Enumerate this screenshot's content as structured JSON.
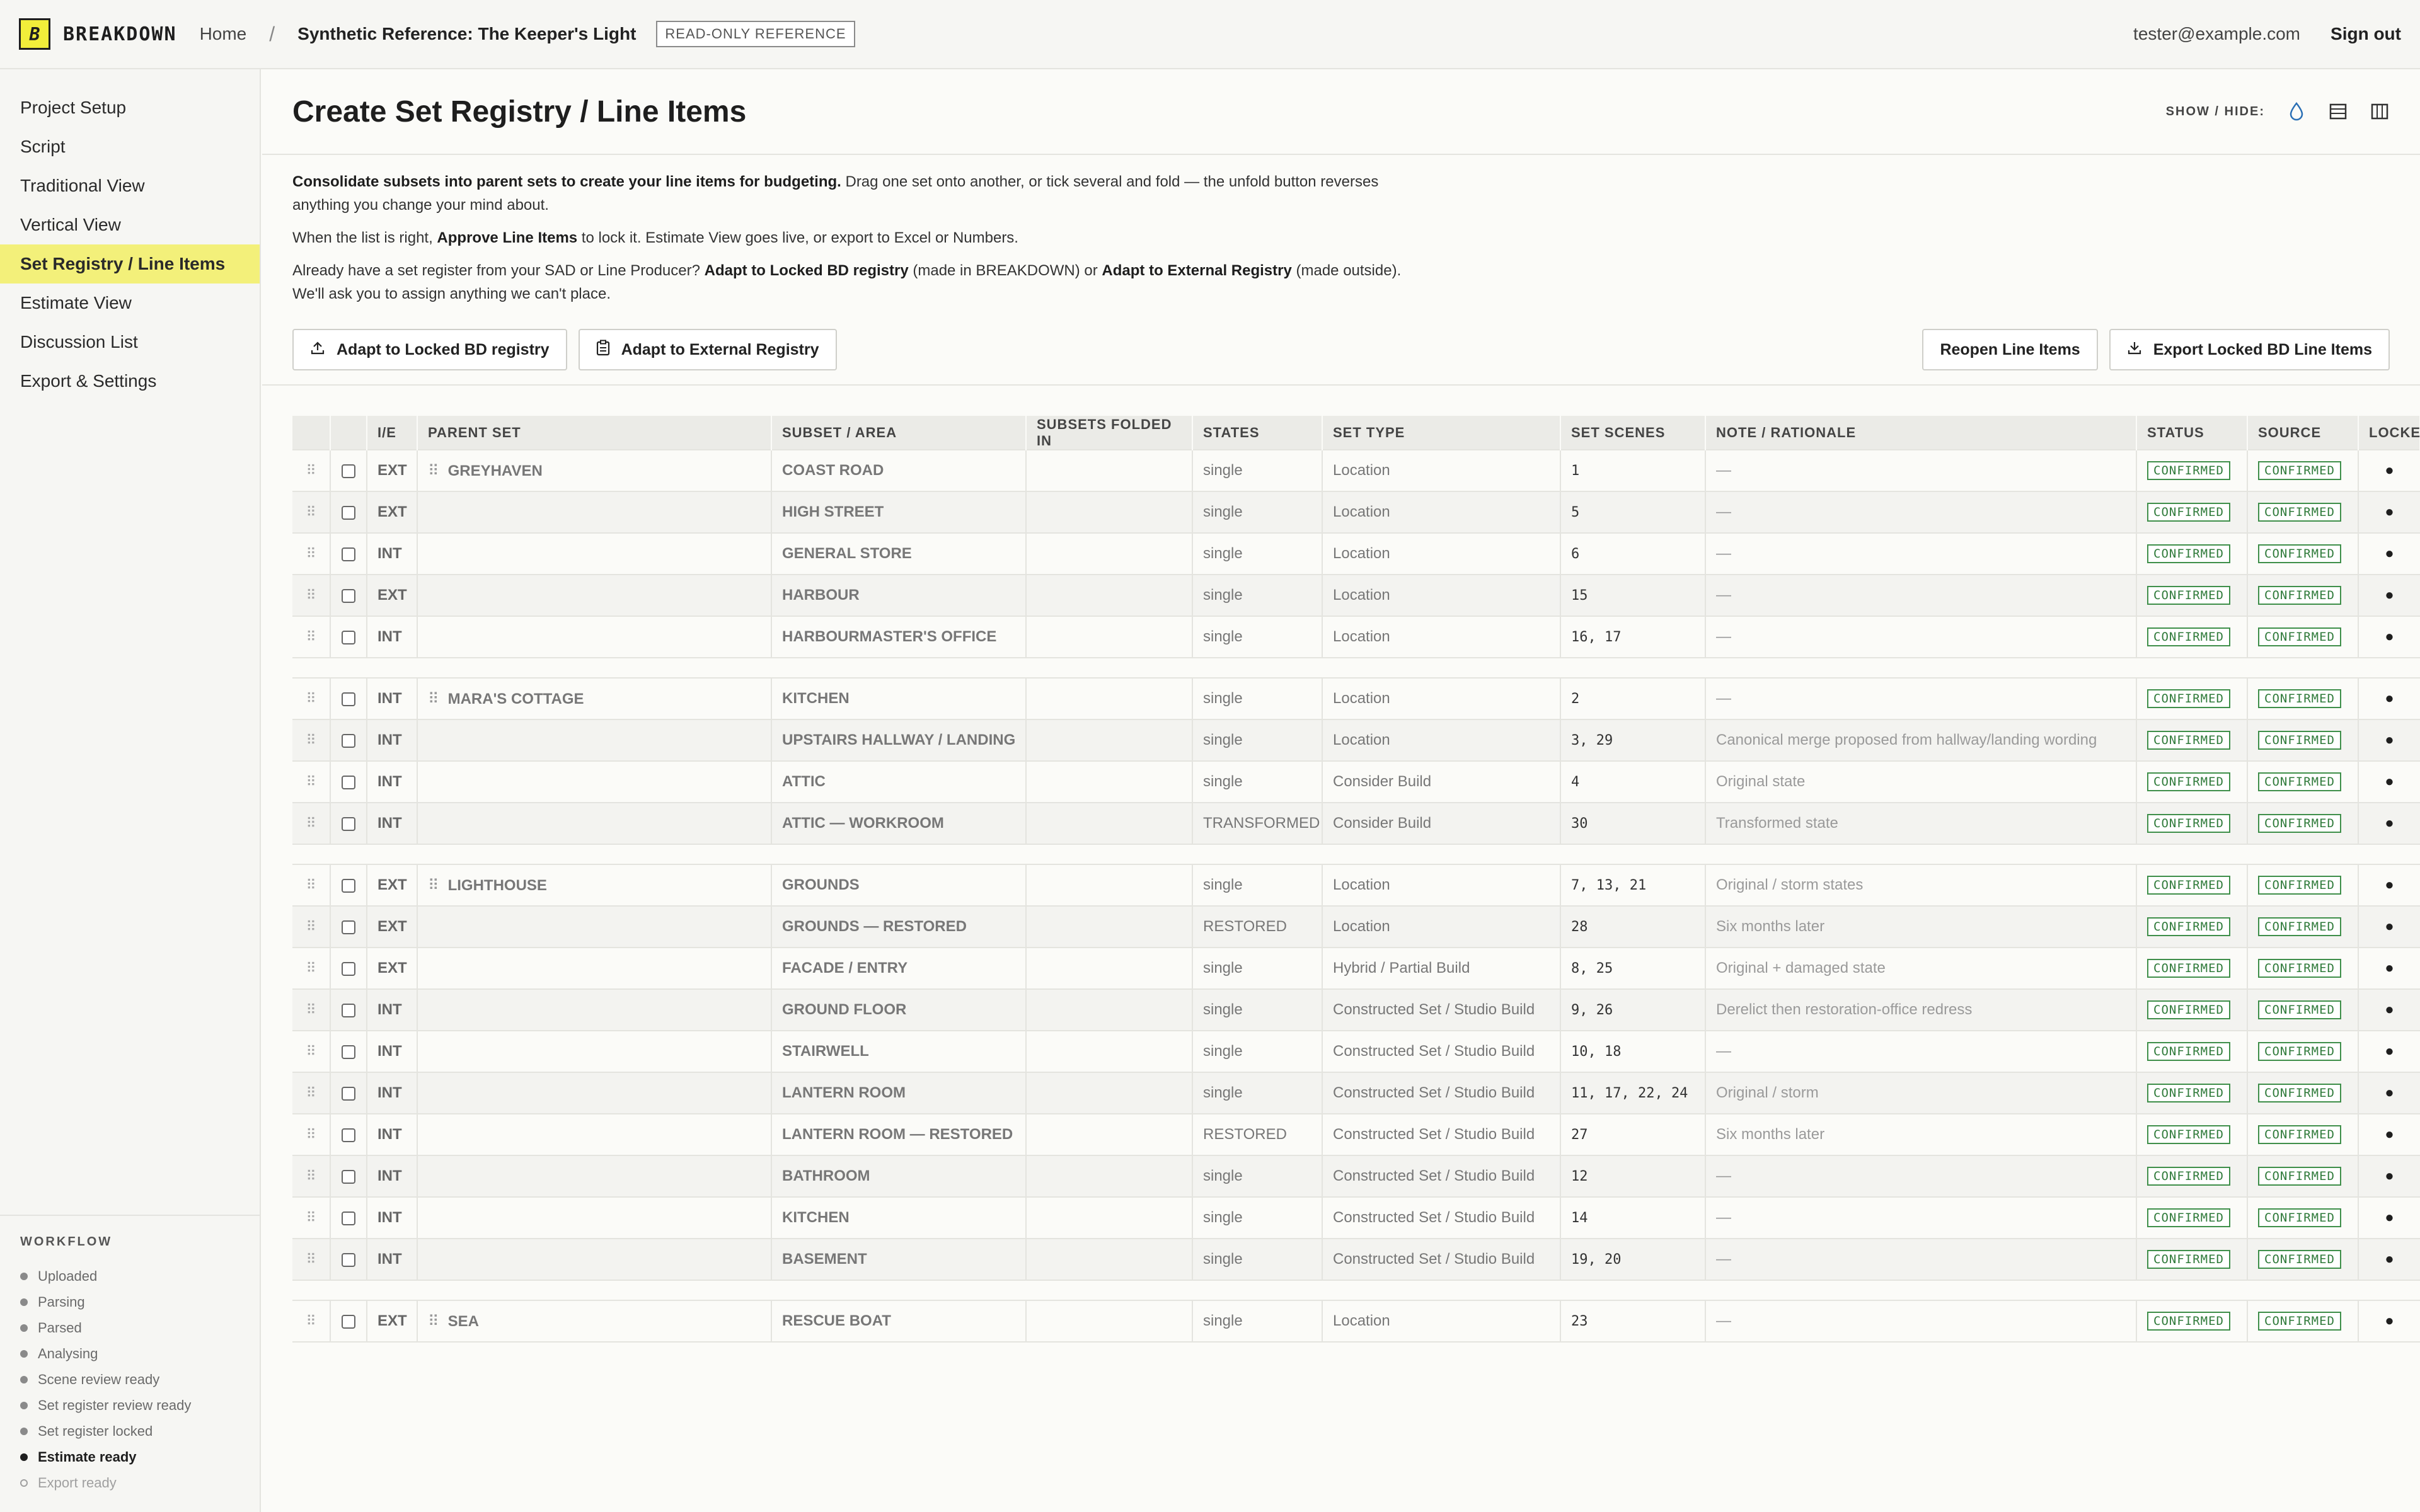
{
  "app": {
    "logo_letter": "B",
    "brand": "BREAKDOWN",
    "accent": "#f2ee3a"
  },
  "breadcrumb": {
    "home": "Home",
    "separator": "/",
    "project": "Synthetic Reference: The Keeper's Light",
    "badge": "READ-ONLY REFERENCE"
  },
  "user": {
    "email": "tester@example.com",
    "signout": "Sign out"
  },
  "sidebar": {
    "items": [
      {
        "label": "Project Setup"
      },
      {
        "label": "Script"
      },
      {
        "label": "Traditional View"
      },
      {
        "label": "Vertical View"
      },
      {
        "label": "Set Registry / Line Items",
        "active": true
      },
      {
        "label": "Estimate View"
      },
      {
        "label": "Discussion List"
      },
      {
        "label": "Export & Settings"
      }
    ],
    "workflow_title": "WORKFLOW",
    "workflow": [
      {
        "label": "Uploaded",
        "state": "done"
      },
      {
        "label": "Parsing",
        "state": "done"
      },
      {
        "label": "Parsed",
        "state": "done"
      },
      {
        "label": "Analysing",
        "state": "done"
      },
      {
        "label": "Scene review ready",
        "state": "done"
      },
      {
        "label": "Set register review ready",
        "state": "done"
      },
      {
        "label": "Set register locked",
        "state": "done"
      },
      {
        "label": "Estimate ready",
        "state": "current"
      },
      {
        "label": "Export ready",
        "state": "pending"
      }
    ]
  },
  "page": {
    "title": "Create Set Registry / Line Items",
    "showhide_label": "SHOW / HIDE:",
    "icons": [
      "droplet-icon",
      "rows-icon",
      "columns-icon"
    ]
  },
  "intro": {
    "p1_bold": "Consolidate subsets into parent sets to create your line items for budgeting.",
    "p1_rest": " Drag one set onto another, or tick several and fold — the unfold button reverses anything you change your mind about.",
    "p2_a": "When the list is right, ",
    "p2_bold": "Approve Line Items",
    "p2_b": " to lock it. Estimate View goes live, or export to Excel or Numbers.",
    "p3_a": "Already have a set register from your SAD or Line Producer? ",
    "p3_bold1": "Adapt to Locked BD registry",
    "p3_b": " (made in BREAKDOWN) or ",
    "p3_bold2": "Adapt to External Registry",
    "p3_c": " (made outside). We'll ask you to assign anything we can't place."
  },
  "actions": {
    "adapt_locked": "Adapt to Locked BD registry",
    "adapt_external": "Adapt to External Registry",
    "reopen": "Reopen Line Items",
    "export": "Export Locked BD Line Items"
  },
  "table": {
    "columns": [
      "",
      "",
      "I/E",
      "PARENT SET",
      "SUBSET / AREA",
      "SUBSETS FOLDED IN",
      "STATES",
      "SET TYPE",
      "SET SCENES",
      "NOTE / RATIONALE",
      "STATUS",
      "SOURCE",
      "LOCKED"
    ],
    "groups": [
      {
        "rows": [
          {
            "ie": "EXT",
            "parent": "GREYHAVEN",
            "subset": "COAST ROAD",
            "folded": "",
            "states": "single",
            "type": "Location",
            "scenes": "1",
            "note": "—",
            "status": "CONFIRMED",
            "source": "CONFIRMED",
            "locked": "●"
          },
          {
            "ie": "EXT",
            "parent": "",
            "subset": "HIGH STREET",
            "folded": "",
            "states": "single",
            "type": "Location",
            "scenes": "5",
            "note": "—",
            "status": "CONFIRMED",
            "source": "CONFIRMED",
            "locked": "●"
          },
          {
            "ie": "INT",
            "parent": "",
            "subset": "GENERAL STORE",
            "folded": "",
            "states": "single",
            "type": "Location",
            "scenes": "6",
            "note": "—",
            "status": "CONFIRMED",
            "source": "CONFIRMED",
            "locked": "●"
          },
          {
            "ie": "EXT",
            "parent": "",
            "subset": "HARBOUR",
            "folded": "",
            "states": "single",
            "type": "Location",
            "scenes": "15",
            "note": "—",
            "status": "CONFIRMED",
            "source": "CONFIRMED",
            "locked": "●"
          },
          {
            "ie": "INT",
            "parent": "",
            "subset": "HARBOURMASTER'S OFFICE",
            "folded": "",
            "states": "single",
            "type": "Location",
            "scenes": "16, 17",
            "note": "—",
            "status": "CONFIRMED",
            "source": "CONFIRMED",
            "locked": "●"
          }
        ]
      },
      {
        "rows": [
          {
            "ie": "INT",
            "parent": "MARA'S COTTAGE",
            "subset": "KITCHEN",
            "folded": "",
            "states": "single",
            "type": "Location",
            "scenes": "2",
            "note": "—",
            "status": "CONFIRMED",
            "source": "CONFIRMED",
            "locked": "●"
          },
          {
            "ie": "INT",
            "parent": "",
            "subset": "UPSTAIRS HALLWAY / LANDING",
            "folded": "",
            "states": "single",
            "type": "Location",
            "scenes": "3, 29",
            "note": "Canonical merge proposed from hallway/landing wording",
            "status": "CONFIRMED",
            "source": "CONFIRMED",
            "locked": "●"
          },
          {
            "ie": "INT",
            "parent": "",
            "subset": "ATTIC",
            "folded": "",
            "states": "single",
            "type": "Consider Build",
            "scenes": "4",
            "note": "Original state",
            "status": "CONFIRMED",
            "source": "CONFIRMED",
            "locked": "●"
          },
          {
            "ie": "INT",
            "parent": "",
            "subset": "ATTIC — WORKROOM",
            "folded": "",
            "states": "TRANSFORMED",
            "type": "Consider Build",
            "scenes": "30",
            "note": "Transformed state",
            "status": "CONFIRMED",
            "source": "CONFIRMED",
            "locked": "●"
          }
        ]
      },
      {
        "rows": [
          {
            "ie": "EXT",
            "parent": "LIGHTHOUSE",
            "subset": "GROUNDS",
            "folded": "",
            "states": "single",
            "type": "Location",
            "scenes": "7, 13, 21",
            "note": "Original / storm states",
            "status": "CONFIRMED",
            "source": "CONFIRMED",
            "locked": "●"
          },
          {
            "ie": "EXT",
            "parent": "",
            "subset": "GROUNDS — RESTORED",
            "folded": "",
            "states": "RESTORED",
            "type": "Location",
            "scenes": "28",
            "note": "Six months later",
            "status": "CONFIRMED",
            "source": "CONFIRMED",
            "locked": "●"
          },
          {
            "ie": "EXT",
            "parent": "",
            "subset": "FACADE / ENTRY",
            "folded": "",
            "states": "single",
            "type": "Hybrid / Partial Build",
            "scenes": "8, 25",
            "note": "Original + damaged state",
            "status": "CONFIRMED",
            "source": "CONFIRMED",
            "locked": "●"
          },
          {
            "ie": "INT",
            "parent": "",
            "subset": "GROUND FLOOR",
            "folded": "",
            "states": "single",
            "type": "Constructed Set / Studio Build",
            "scenes": "9, 26",
            "note": "Derelict then restoration-office redress",
            "status": "CONFIRMED",
            "source": "CONFIRMED",
            "locked": "●"
          },
          {
            "ie": "INT",
            "parent": "",
            "subset": "STAIRWELL",
            "folded": "",
            "states": "single",
            "type": "Constructed Set / Studio Build",
            "scenes": "10, 18",
            "note": "—",
            "status": "CONFIRMED",
            "source": "CONFIRMED",
            "locked": "●"
          },
          {
            "ie": "INT",
            "parent": "",
            "subset": "LANTERN ROOM",
            "folded": "",
            "states": "single",
            "type": "Constructed Set / Studio Build",
            "scenes": "11, 17, 22, 24",
            "note": "Original / storm",
            "status": "CONFIRMED",
            "source": "CONFIRMED",
            "locked": "●"
          },
          {
            "ie": "INT",
            "parent": "",
            "subset": "LANTERN ROOM — RESTORED",
            "folded": "",
            "states": "RESTORED",
            "type": "Constructed Set / Studio Build",
            "scenes": "27",
            "note": "Six months later",
            "status": "CONFIRMED",
            "source": "CONFIRMED",
            "locked": "●"
          },
          {
            "ie": "INT",
            "parent": "",
            "subset": "BATHROOM",
            "folded": "",
            "states": "single",
            "type": "Constructed Set / Studio Build",
            "scenes": "12",
            "note": "—",
            "status": "CONFIRMED",
            "source": "CONFIRMED",
            "locked": "●"
          },
          {
            "ie": "INT",
            "parent": "",
            "subset": "KITCHEN",
            "folded": "",
            "states": "single",
            "type": "Constructed Set / Studio Build",
            "scenes": "14",
            "note": "—",
            "status": "CONFIRMED",
            "source": "CONFIRMED",
            "locked": "●"
          },
          {
            "ie": "INT",
            "parent": "",
            "subset": "BASEMENT",
            "folded": "",
            "states": "single",
            "type": "Constructed Set / Studio Build",
            "scenes": "19, 20",
            "note": "—",
            "status": "CONFIRMED",
            "source": "CONFIRMED",
            "locked": "●"
          }
        ]
      },
      {
        "rows": [
          {
            "ie": "EXT",
            "parent": "SEA",
            "subset": "RESCUE BOAT",
            "folded": "",
            "states": "single",
            "type": "Location",
            "scenes": "23",
            "note": "—",
            "status": "CONFIRMED",
            "source": "CONFIRMED",
            "locked": "●"
          }
        ]
      }
    ]
  }
}
